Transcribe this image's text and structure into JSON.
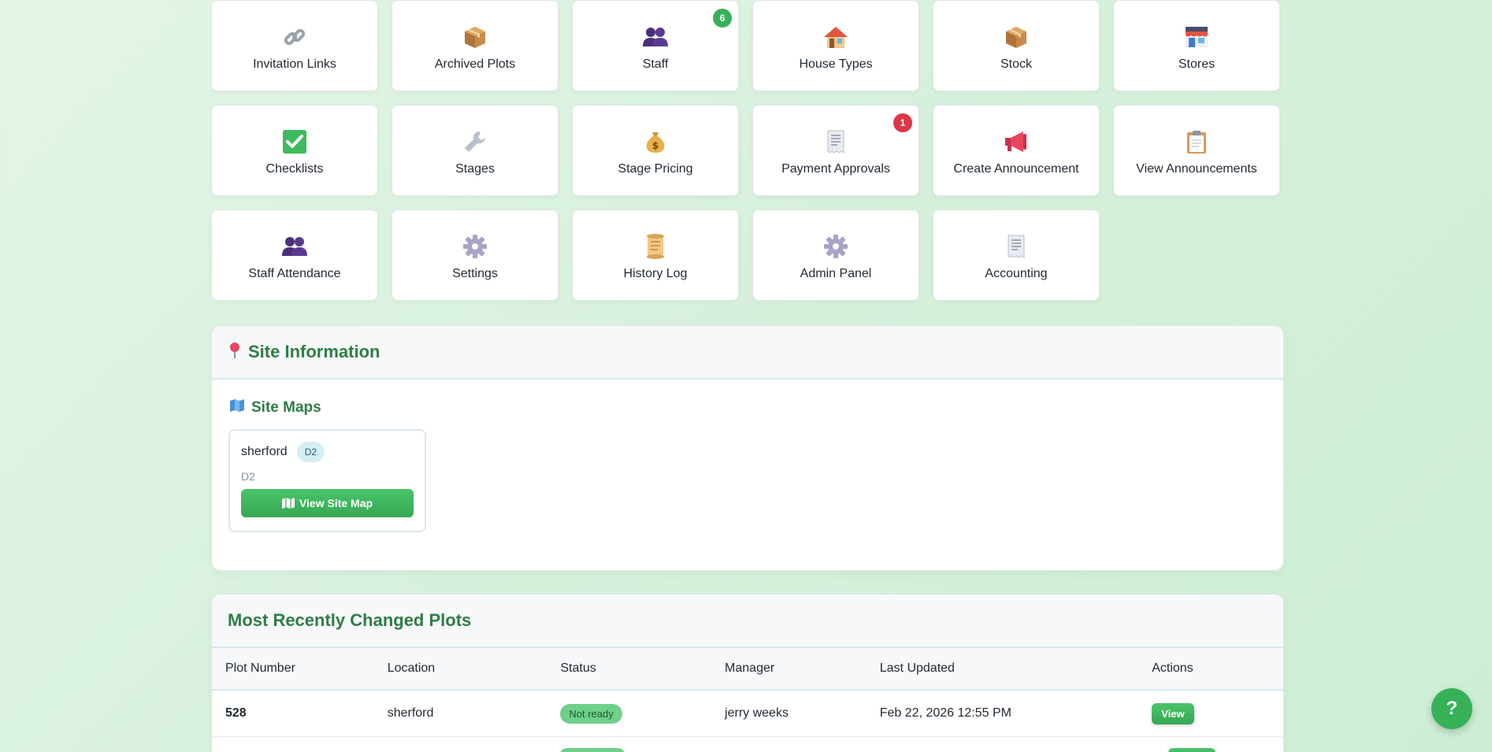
{
  "tiles": [
    {
      "label": "Invitation Links",
      "icon": "link-icon",
      "badge": ""
    },
    {
      "label": "Archived Plots",
      "icon": "package-icon",
      "badge": ""
    },
    {
      "label": "Staff",
      "icon": "people-icon",
      "badge": "6"
    },
    {
      "label": "House Types",
      "icon": "house-icon",
      "badge": ""
    },
    {
      "label": "Stock",
      "icon": "package-icon",
      "badge": ""
    },
    {
      "label": "Stores",
      "icon": "store-icon",
      "badge": ""
    },
    {
      "label": "Checklists",
      "icon": "checkbox-icon",
      "badge": ""
    },
    {
      "label": "Stages",
      "icon": "wrench-icon",
      "badge": ""
    },
    {
      "label": "Stage Pricing",
      "icon": "money-bag-icon",
      "badge": ""
    },
    {
      "label": "Payment Approvals",
      "icon": "receipt-icon",
      "badge": "1"
    },
    {
      "label": "Create Announcement",
      "icon": "megaphone-icon",
      "badge": ""
    },
    {
      "label": "View Announcements",
      "icon": "clipboard-icon",
      "badge": ""
    },
    {
      "label": "Staff Attendance",
      "icon": "people-icon",
      "badge": ""
    },
    {
      "label": "Settings",
      "icon": "gear-icon",
      "badge": ""
    },
    {
      "label": "History Log",
      "icon": "scroll-icon",
      "badge": ""
    },
    {
      "label": "Admin Panel",
      "icon": "gear-icon",
      "badge": ""
    },
    {
      "label": "Accounting",
      "icon": "receipt-icon",
      "badge": ""
    }
  ],
  "badge_colors": {
    "staff": "#36b158",
    "payment": "#dc3545"
  },
  "site_info": {
    "title": "Site Information",
    "maps_title": "Site Maps",
    "map": {
      "name": "sherford",
      "pill": "D2",
      "sub": "D2",
      "button": "View Site Map"
    }
  },
  "plots": {
    "title": "Most Recently Changed Plots",
    "headers": [
      "Plot Number",
      "Location",
      "Status",
      "Manager",
      "Last Updated",
      "Actions"
    ],
    "rows": [
      {
        "plot": "528",
        "location": "sherford",
        "status": "Not ready",
        "manager": "jerry weeks",
        "updated": "Feb 22, 2026 12:55 PM",
        "action": "View"
      }
    ]
  },
  "help": {
    "label": "?"
  }
}
